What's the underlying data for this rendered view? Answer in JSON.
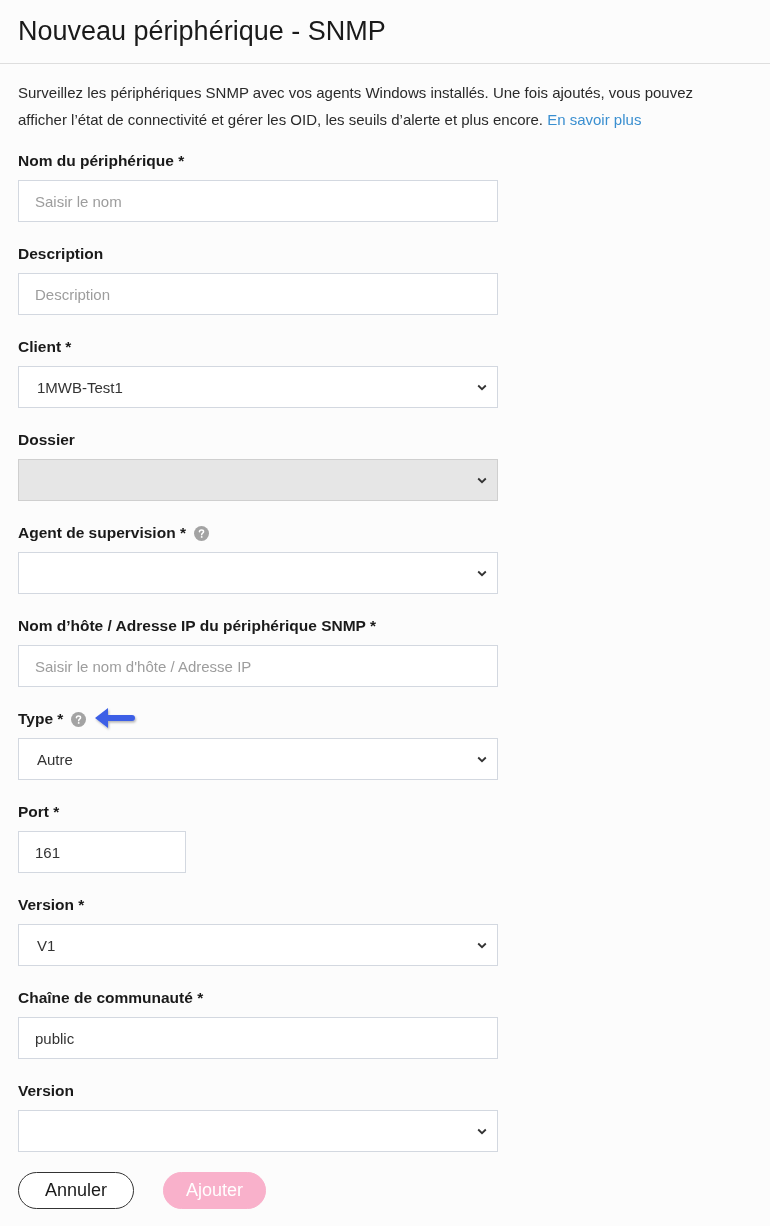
{
  "title": "Nouveau périphérique - SNMP",
  "intro": {
    "text": "Surveillez les périphériques SNMP avec vos agents Windows installés. Une fois ajoutés, vous pouvez afficher l’état de connectivité et gérer les OID, les seuils d’alerte et plus encore.",
    "link": "En savoir plus"
  },
  "fields": [
    {
      "label": "Nom du périphérique *",
      "kind": "text",
      "placeholder": "Saisir le nom",
      "help": false,
      "pointer": false,
      "disabled": false
    },
    {
      "label": "Description",
      "kind": "text",
      "placeholder": "Description",
      "help": false,
      "pointer": false,
      "disabled": false
    },
    {
      "label": "Client *",
      "kind": "select",
      "value": "1MWB-Test1",
      "help": false,
      "pointer": false,
      "disabled": false
    },
    {
      "label": "Dossier",
      "kind": "select",
      "help": false,
      "pointer": false,
      "disabled": true
    },
    {
      "label": "Agent de supervision *",
      "kind": "select",
      "help": true,
      "pointer": false,
      "disabled": false
    },
    {
      "label": "Nom d’hôte / Adresse IP du périphérique SNMP *",
      "kind": "text",
      "placeholder": "Saisir le nom d'hôte / Adresse IP",
      "help": false,
      "pointer": false,
      "disabled": false
    },
    {
      "label": "Type *",
      "kind": "select",
      "value": "Autre",
      "help": true,
      "pointer": true,
      "disabled": false
    },
    {
      "label": "Port *",
      "kind": "number",
      "value": "161",
      "help": false,
      "pointer": false,
      "disabled": false
    },
    {
      "label": "Version *",
      "kind": "select",
      "value": "V1",
      "help": false,
      "pointer": false,
      "disabled": false
    },
    {
      "label": "Chaîne de communauté *",
      "kind": "text",
      "value": "public",
      "help": false,
      "pointer": false,
      "disabled": false
    },
    {
      "label": "Version",
      "kind": "select",
      "help": false,
      "pointer": false,
      "disabled": false
    }
  ],
  "buttons": [
    {
      "label": "Annuler",
      "kind": "secondary",
      "disabled": false
    },
    {
      "label": "Ajouter",
      "kind": "primary",
      "disabled": true
    }
  ]
}
